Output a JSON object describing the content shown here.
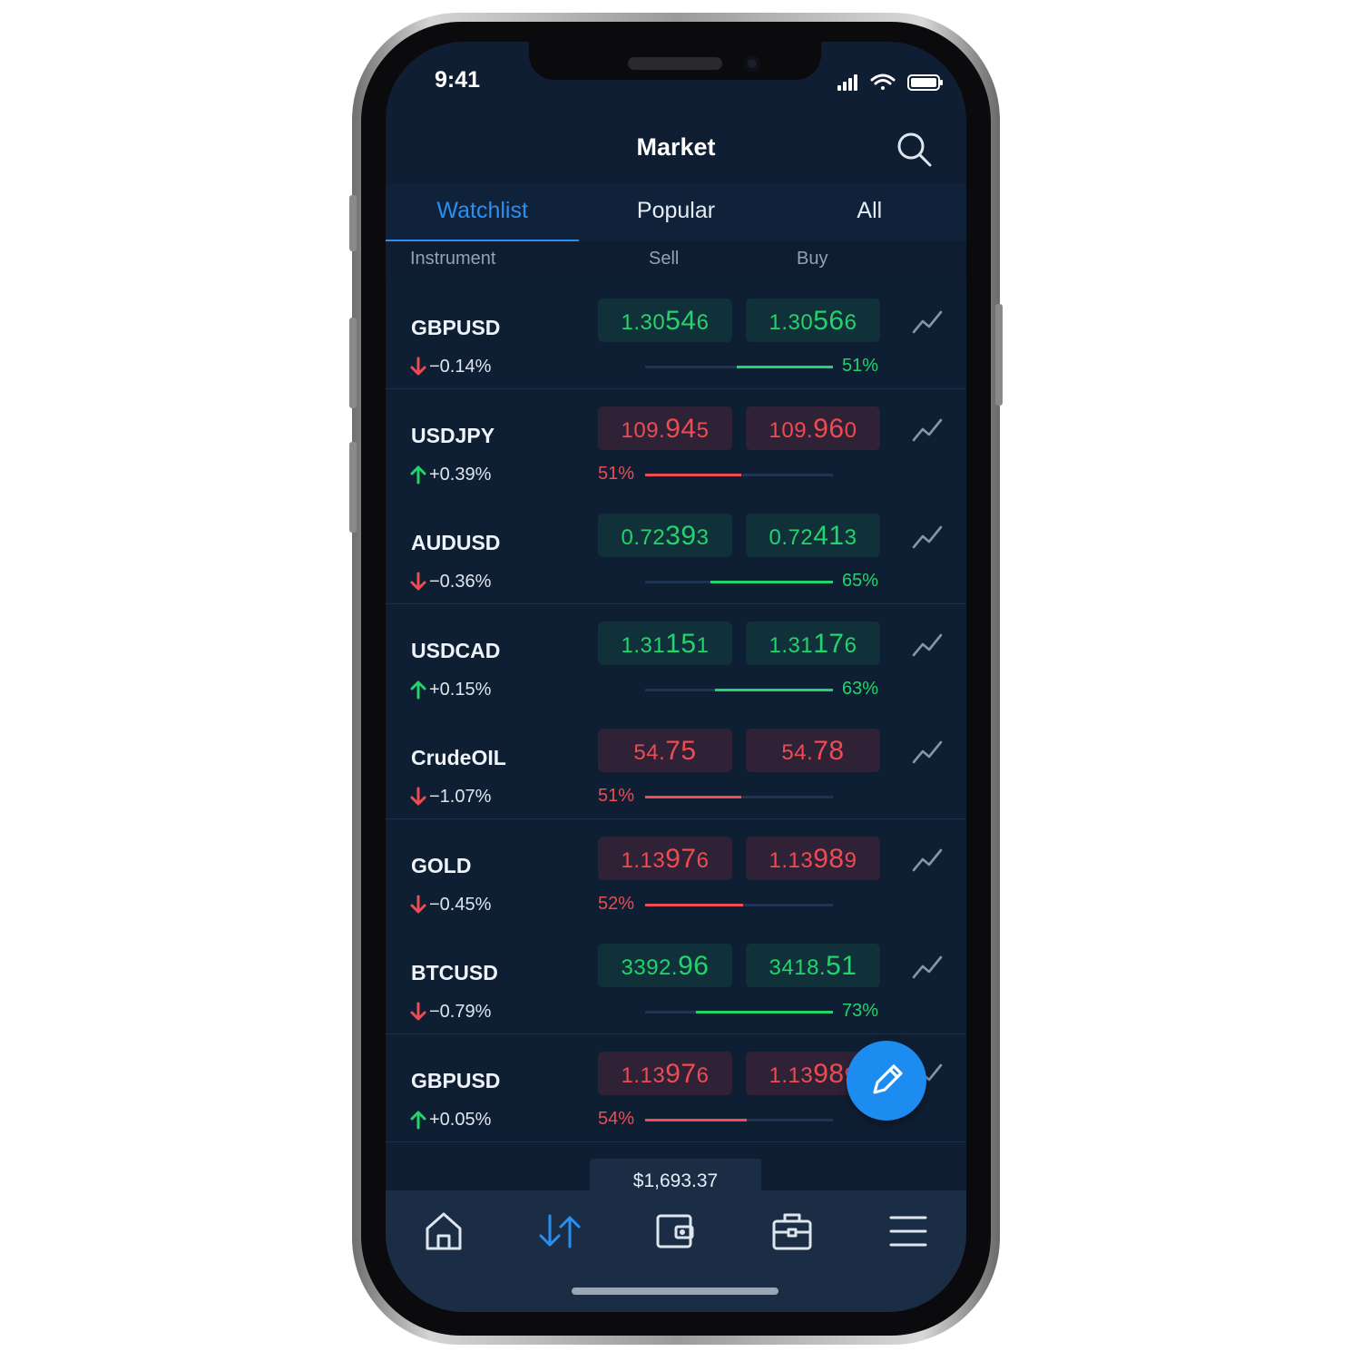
{
  "status_bar": {
    "time": "9:41"
  },
  "header": {
    "title": "Market"
  },
  "tabs": [
    {
      "label": "Watchlist",
      "active": true
    },
    {
      "label": "Popular",
      "active": false
    },
    {
      "label": "All",
      "active": false
    }
  ],
  "columns": {
    "instrument": "Instrument",
    "sell": "Sell",
    "buy": "Buy"
  },
  "rows": [
    {
      "name": "GBPUSD",
      "change": "−0.14%",
      "direction": "down",
      "sell": {
        "small": "1.30",
        "big": "54",
        "tail": "6"
      },
      "buy": {
        "small": "1.30",
        "big": "56",
        "tail": "6"
      },
      "trend": "green",
      "sentiment": 51,
      "sentiment_label": "51%"
    },
    {
      "name": "USDJPY",
      "change": "+0.39%",
      "direction": "up",
      "sell": {
        "small": "109.",
        "big": "94",
        "tail": "5"
      },
      "buy": {
        "small": "109.",
        "big": "96",
        "tail": "0"
      },
      "trend": "red",
      "sentiment": 51,
      "sentiment_label": "51%"
    },
    {
      "name": "AUDUSD",
      "change": "−0.36%",
      "direction": "down",
      "sell": {
        "small": "0.72",
        "big": "39",
        "tail": "3"
      },
      "buy": {
        "small": "0.72",
        "big": "41",
        "tail": "3"
      },
      "trend": "green",
      "sentiment": 65,
      "sentiment_label": "65%"
    },
    {
      "name": "USDCAD",
      "change": "+0.15%",
      "direction": "up",
      "sell": {
        "small": "1.31",
        "big": "15",
        "tail": "1"
      },
      "buy": {
        "small": "1.31",
        "big": "17",
        "tail": "6"
      },
      "trend": "green",
      "sentiment": 63,
      "sentiment_label": "63%"
    },
    {
      "name": "CrudeOIL",
      "change": "−1.07%",
      "direction": "down",
      "sell": {
        "small": "54.",
        "big": "75",
        "tail": ""
      },
      "buy": {
        "small": "54.",
        "big": "78",
        "tail": ""
      },
      "trend": "red",
      "sentiment": 51,
      "sentiment_label": "51%"
    },
    {
      "name": "GOLD",
      "change": "−0.45%",
      "direction": "down",
      "sell": {
        "small": "1.13",
        "big": "97",
        "tail": "6"
      },
      "buy": {
        "small": "1.13",
        "big": "98",
        "tail": "9"
      },
      "trend": "red",
      "sentiment": 52,
      "sentiment_label": "52%"
    },
    {
      "name": "BTCUSD",
      "change": "−0.79%",
      "direction": "down",
      "sell": {
        "small": "3392.",
        "big": "96",
        "tail": ""
      },
      "buy": {
        "small": "3418.",
        "big": "51",
        "tail": ""
      },
      "trend": "green",
      "sentiment": 73,
      "sentiment_label": "73%"
    },
    {
      "name": "GBPUSD",
      "change": "+0.05%",
      "direction": "up",
      "sell": {
        "small": "1.13",
        "big": "97",
        "tail": "6"
      },
      "buy": {
        "small": "1.13",
        "big": "98",
        "tail": "9"
      },
      "trend": "red",
      "sentiment": 54,
      "sentiment_label": "54%"
    }
  ],
  "balance": "$1,693.37",
  "nav": [
    {
      "icon": "home-icon",
      "active": false
    },
    {
      "icon": "trade-arrows-icon",
      "active": true
    },
    {
      "icon": "wallet-icon",
      "active": false
    },
    {
      "icon": "portfolio-briefcase-icon",
      "active": false
    },
    {
      "icon": "menu-icon",
      "active": false
    }
  ],
  "colors": {
    "accent": "#1d8cf0",
    "up": "#23d36b",
    "down": "#ee4b52",
    "background": "#0f1e32"
  }
}
